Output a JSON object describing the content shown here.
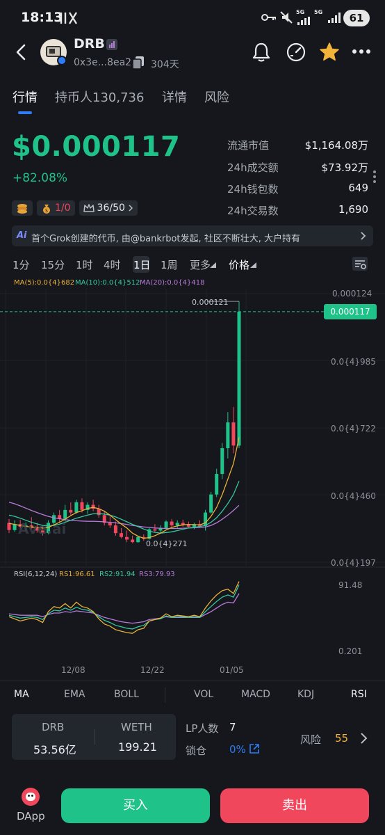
{
  "status": {
    "time": "18:13",
    "battery": "61",
    "net1": "5G",
    "net2": "5G"
  },
  "header": {
    "symbol": "DRB",
    "address": "0x3e...8ea2",
    "age": "304天"
  },
  "tabs": [
    {
      "label": "行情"
    },
    {
      "label": "持币人130,736"
    },
    {
      "label": "详情"
    },
    {
      "label": "风险"
    }
  ],
  "price": {
    "value": "$0.000117",
    "change": "+82.08%"
  },
  "stats": [
    {
      "label": "流通市值",
      "value": "$1,164.08万"
    },
    {
      "label": "24h成交额",
      "value": "$73.92万"
    },
    {
      "label": "24h钱包数",
      "value": "649"
    },
    {
      "label": "24h交易数",
      "value": "1,690"
    }
  ],
  "badges": {
    "tax": "1/0",
    "score": "36/50"
  },
  "banner": {
    "ai_label": "Ai",
    "text": "首个Grok创建的代币, 由@bankrbot发起, 社区不断壮大, 大户持有"
  },
  "timeframes": [
    "1分",
    "15分",
    "1时",
    "4时",
    "1日",
    "1周",
    "更多",
    "价格"
  ],
  "ma_legend": [
    {
      "label": "MA(5):0.0{4}682",
      "color": "#e8b13a"
    },
    {
      "label": "MA(10):0.0{4}512",
      "color": "#35c7a0"
    },
    {
      "label": "MA(20):0.0{4}418",
      "color": "#b77bd8"
    }
  ],
  "chart_axis": {
    "y_ticks": [
      "0.000124",
      "0.0{4}985",
      "0.0{4}722",
      "0.0{4}460",
      "0.0{4}197"
    ],
    "current_price_tag": "0.000117",
    "high_label": "0.000121",
    "low_label": "0.0{4}271",
    "watermark": "Ave.ai",
    "x_ticks": [
      "12/08",
      "12/22",
      "01/05"
    ]
  },
  "rsi": {
    "legend": "RSI(6,12,24)",
    "rs1": "RS1:96.61",
    "rs2": "RS2:91.94",
    "rs3": "RS3:79.93",
    "top": "91.48",
    "bottom": "0.201"
  },
  "indicator_tabs": [
    "MA",
    "EMA",
    "BOLL",
    "VOL",
    "MACD",
    "KDJ",
    "RSI"
  ],
  "pool": {
    "token_a": "DRB",
    "amount_a": "53.56亿",
    "token_b": "WETH",
    "amount_b": "199.21",
    "lp_label": "LP人数",
    "lp_value": "7",
    "lock_label": "锁仓",
    "lock_value": "0%",
    "risk_label": "风险",
    "risk_value": "55"
  },
  "bottom": {
    "dapp": "DApp",
    "buy": "买入",
    "sell": "卖出"
  },
  "colors": {
    "up": "#1fc38a",
    "down": "#f0475c",
    "accent": "#2f7cf6",
    "warning": "#f2b33a"
  },
  "chart_data": {
    "type": "candlestick",
    "unit": "USD",
    "axis_ticks": [
      0.000124,
      9.85e-05,
      7.22e-05,
      4.6e-05,
      1.97e-05
    ],
    "x_ticks": [
      "12/08",
      "12/22",
      "01/05"
    ],
    "candles": [
      {
        "o": 3.5e-05,
        "h": 3.65e-05,
        "l": 3.1e-05,
        "c": 3.22e-05
      },
      {
        "o": 3.22e-05,
        "h": 3.6e-05,
        "l": 3.15e-05,
        "c": 3.45e-05
      },
      {
        "o": 3.45e-05,
        "h": 3.62e-05,
        "l": 3.25e-05,
        "c": 3.35e-05
      },
      {
        "o": 3.35e-05,
        "h": 3.52e-05,
        "l": 3.18e-05,
        "c": 3.4e-05
      },
      {
        "o": 3.4e-05,
        "h": 3.72e-05,
        "l": 3.26e-05,
        "c": 3.3e-05
      },
      {
        "o": 3.3e-05,
        "h": 3.5e-05,
        "l": 3.12e-05,
        "c": 3.2e-05
      },
      {
        "o": 3.2e-05,
        "h": 3.4e-05,
        "l": 3e-05,
        "c": 3.1e-05
      },
      {
        "o": 3.1e-05,
        "h": 3.6e-05,
        "l": 3.05e-05,
        "c": 3.5e-05
      },
      {
        "o": 3.5e-05,
        "h": 3.9e-05,
        "l": 3.4e-05,
        "c": 3.8e-05
      },
      {
        "o": 3.8e-05,
        "h": 4e-05,
        "l": 3.5e-05,
        "c": 3.65e-05
      },
      {
        "o": 3.65e-05,
        "h": 4.2e-05,
        "l": 3.55e-05,
        "c": 4e-05
      },
      {
        "o": 4e-05,
        "h": 4.3e-05,
        "l": 3.8e-05,
        "c": 3.9e-05
      },
      {
        "o": 3.9e-05,
        "h": 4.4e-05,
        "l": 3.85e-05,
        "c": 4.3e-05
      },
      {
        "o": 4.3e-05,
        "h": 4.45e-05,
        "l": 3.9e-05,
        "c": 4e-05
      },
      {
        "o": 4e-05,
        "h": 4.3e-05,
        "l": 3.85e-05,
        "c": 4.2e-05
      },
      {
        "o": 4.2e-05,
        "h": 4.4e-05,
        "l": 3.95e-05,
        "c": 4.05e-05
      },
      {
        "o": 4.05e-05,
        "h": 4.2e-05,
        "l": 3.7e-05,
        "c": 3.8e-05
      },
      {
        "o": 3.8e-05,
        "h": 3.95e-05,
        "l": 3.4e-05,
        "c": 3.5e-05
      },
      {
        "o": 3.5e-05,
        "h": 3.75e-05,
        "l": 3.3e-05,
        "c": 3.4e-05
      },
      {
        "o": 3.4e-05,
        "h": 3.55e-05,
        "l": 3e-05,
        "c": 3.1e-05
      },
      {
        "o": 3.1e-05,
        "h": 3.3e-05,
        "l": 2.9e-05,
        "c": 2.95e-05
      },
      {
        "o": 2.95e-05,
        "h": 3.2e-05,
        "l": 2.75e-05,
        "c": 2.85e-05
      },
      {
        "o": 2.85e-05,
        "h": 3e-05,
        "l": 2.71e-05,
        "c": 2.75e-05
      },
      {
        "o": 2.75e-05,
        "h": 3e-05,
        "l": 2.72e-05,
        "c": 2.95e-05
      },
      {
        "o": 2.95e-05,
        "h": 3.05e-05,
        "l": 2.8e-05,
        "c": 2.88e-05
      },
      {
        "o": 2.88e-05,
        "h": 3.3e-05,
        "l": 2.85e-05,
        "c": 3.25e-05
      },
      {
        "o": 3.25e-05,
        "h": 3.45e-05,
        "l": 3.15e-05,
        "c": 3.2e-05
      },
      {
        "o": 3.2e-05,
        "h": 3.4e-05,
        "l": 3.1e-05,
        "c": 3.3e-05
      },
      {
        "o": 3.3e-05,
        "h": 3.6e-05,
        "l": 3.25e-05,
        "c": 3.55e-05
      },
      {
        "o": 3.55e-05,
        "h": 3.65e-05,
        "l": 3.35e-05,
        "c": 3.4e-05
      },
      {
        "o": 3.4e-05,
        "h": 3.6e-05,
        "l": 3.3e-05,
        "c": 3.5e-05
      },
      {
        "o": 3.5e-05,
        "h": 3.62e-05,
        "l": 3.35e-05,
        "c": 3.42e-05
      },
      {
        "o": 3.42e-05,
        "h": 3.55e-05,
        "l": 3.3e-05,
        "c": 3.35e-05
      },
      {
        "o": 3.35e-05,
        "h": 3.5e-05,
        "l": 3.25e-05,
        "c": 3.45e-05
      },
      {
        "o": 3.45e-05,
        "h": 3.6e-05,
        "l": 3.3e-05,
        "c": 3.38e-05
      },
      {
        "o": 3.38e-05,
        "h": 4e-05,
        "l": 3.2e-05,
        "c": 3.9e-05
      },
      {
        "o": 3.9e-05,
        "h": 4.7e-05,
        "l": 3.85e-05,
        "c": 4.6e-05
      },
      {
        "o": 4.6e-05,
        "h": 5.6e-05,
        "l": 4.5e-05,
        "c": 5.4e-05
      },
      {
        "o": 5.4e-05,
        "h": 6.6e-05,
        "l": 5.2e-05,
        "c": 6.4e-05
      },
      {
        "o": 6.4e-05,
        "h": 7.8e-05,
        "l": 6e-05,
        "c": 7.4e-05
      },
      {
        "o": 7.4e-05,
        "h": 8e-05,
        "l": 6.2e-05,
        "c": 6.5e-05
      },
      {
        "o": 6.5e-05,
        "h": 0.000121,
        "l": 6.4e-05,
        "c": 0.000117
      }
    ],
    "ma5": [
      3.48e-05,
      3.44e-05,
      3.4e-05,
      3.36e-05,
      3.34e-05,
      3.32e-05,
      3.3e-05,
      3.32e-05,
      3.42e-05,
      3.52e-05,
      3.64e-05,
      3.78e-05,
      3.9e-05,
      3.97e-05,
      4.06e-05,
      4.1e-05,
      4.05e-05,
      3.95e-05,
      3.8e-05,
      3.62e-05,
      3.45e-05,
      3.3e-05,
      3.1e-05,
      2.98e-05,
      2.9e-05,
      2.93e-05,
      3e-05,
      3.1e-05,
      3.22e-05,
      3.32e-05,
      3.38e-05,
      3.42e-05,
      3.44e-05,
      3.43e-05,
      3.42e-05,
      3.5e-05,
      3.75e-05,
      4.1e-05,
      4.6e-05,
      5.2e-05,
      5.8e-05,
      6.82e-05
    ],
    "ma10": [
      3.8e-05,
      3.75e-05,
      3.68e-05,
      3.6e-05,
      3.52e-05,
      3.46e-05,
      3.4e-05,
      3.38e-05,
      3.4e-05,
      3.45e-05,
      3.52e-05,
      3.6e-05,
      3.68e-05,
      3.74e-05,
      3.8e-05,
      3.85e-05,
      3.86e-05,
      3.84e-05,
      3.8e-05,
      3.73e-05,
      3.64e-05,
      3.54e-05,
      3.44e-05,
      3.35e-05,
      3.26e-05,
      3.18e-05,
      3.13e-05,
      3.1e-05,
      3.12e-05,
      3.15e-05,
      3.2e-05,
      3.25e-05,
      3.3e-05,
      3.33e-05,
      3.36e-05,
      3.4e-05,
      3.52e-05,
      3.7e-05,
      3.95e-05,
      4.25e-05,
      4.6e-05,
      5.12e-05
    ],
    "ma20": [
      4.3e-05,
      4.24e-05,
      4.16e-05,
      4.07e-05,
      3.98e-05,
      3.9e-05,
      3.82e-05,
      3.75e-05,
      3.7e-05,
      3.66e-05,
      3.62e-05,
      3.6e-05,
      3.58e-05,
      3.57e-05,
      3.56e-05,
      3.56e-05,
      3.55e-05,
      3.54e-05,
      3.52e-05,
      3.5e-05,
      3.47e-05,
      3.44e-05,
      3.4e-05,
      3.37e-05,
      3.34e-05,
      3.32e-05,
      3.3e-05,
      3.29e-05,
      3.28e-05,
      3.28e-05,
      3.28e-05,
      3.29e-05,
      3.3e-05,
      3.31e-05,
      3.32e-05,
      3.34e-05,
      3.4e-05,
      3.5e-05,
      3.64e-05,
      3.8e-05,
      3.98e-05,
      4.18e-05
    ],
    "rsi6": [
      48,
      45,
      42,
      44,
      46,
      44,
      40,
      55,
      62,
      60,
      66,
      60,
      68,
      62,
      60,
      55,
      45,
      38,
      35,
      30,
      28,
      26,
      25,
      30,
      32,
      42,
      44,
      46,
      52,
      48,
      50,
      49,
      48,
      50,
      48,
      60,
      70,
      78,
      84,
      86,
      80,
      96.61
    ],
    "rsi12": [
      50,
      48,
      46,
      47,
      48,
      47,
      44,
      52,
      57,
      56,
      60,
      57,
      61,
      58,
      57,
      54,
      48,
      43,
      40,
      36,
      34,
      32,
      31,
      34,
      36,
      42,
      44,
      45,
      49,
      47,
      48,
      48,
      47,
      48,
      47,
      55,
      62,
      69,
      75,
      78,
      75,
      91.94
    ],
    "rsi24": [
      52,
      51,
      50,
      50,
      50,
      50,
      48,
      51,
      53,
      53,
      55,
      54,
      56,
      55,
      54,
      53,
      50,
      47,
      45,
      43,
      41,
      40,
      39,
      40,
      41,
      44,
      45,
      46,
      48,
      47,
      47,
      47,
      47,
      47,
      47,
      51,
      55,
      60,
      65,
      68,
      67,
      79.93
    ]
  }
}
